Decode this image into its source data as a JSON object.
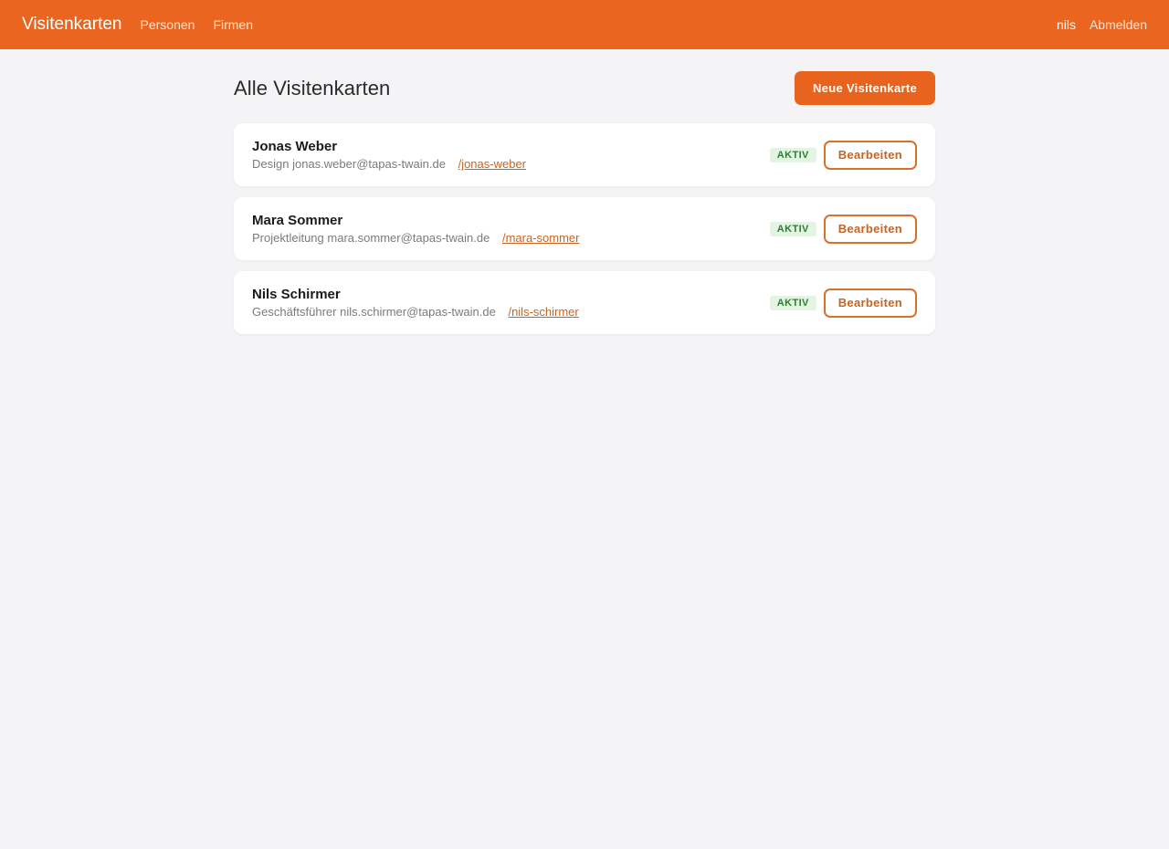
{
  "nav": {
    "brand": "Visitenkarten",
    "links": [
      "Personen",
      "Firmen"
    ],
    "user": "nils",
    "logout": "Abmelden"
  },
  "header": {
    "title": "Alle Visitenkarten",
    "new_button": "Neue Visitenkarte"
  },
  "cards": [
    {
      "name": "Jonas Weber",
      "role": "Design",
      "email": "jonas.weber@tapas-twain.de",
      "slug": "/jonas-weber",
      "status": "AKTIV",
      "edit_label": "Bearbeiten"
    },
    {
      "name": "Mara Sommer",
      "role": "Projektleitung",
      "email": "mara.sommer@tapas-twain.de",
      "slug": "/mara-sommer",
      "status": "AKTIV",
      "edit_label": "Bearbeiten"
    },
    {
      "name": "Nils Schirmer",
      "role": "Geschäftsführer",
      "email": "nils.schirmer@tapas-twain.de",
      "slug": "/nils-schirmer",
      "status": "AKTIV",
      "edit_label": "Bearbeiten"
    }
  ],
  "colors": {
    "brand": "#ea6620",
    "background": "#f4f4f6",
    "badge_bg": "#e3f4e3",
    "badge_text": "#2e7d32",
    "link": "#c8641f"
  }
}
